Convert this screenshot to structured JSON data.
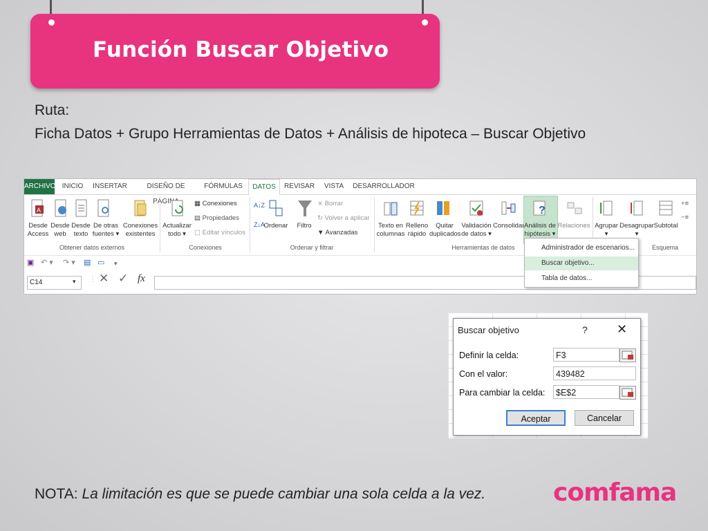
{
  "slide": {
    "title": "Función Buscar Objetivo",
    "ruta_label": "Ruta:",
    "ruta_text": "Ficha Datos + Grupo Herramientas de Datos + Análisis de hipoteca – Buscar Objetivo",
    "nota_label": "NOTA:",
    "nota_text": " La limitación es que se puede cambiar una sola celda a la vez.",
    "logo": "comfama"
  },
  "ribbon": {
    "tabs": [
      "ARCHIVO",
      "INICIO",
      "INSERTAR",
      "DISEÑO DE PÁGINA",
      "FÓRMULAS",
      "DATOS",
      "REVISAR",
      "VISTA",
      "DESARROLLADOR"
    ],
    "buttons": {
      "desde_access": "Desde\nAccess",
      "desde_web": "Desde\nweb",
      "desde_texto": "Desde\ntexto",
      "de_otras": "De otras\nfuentes ▾",
      "conexiones_existentes": "Conexiones\nexistentes",
      "actualizar": "Actualizar\ntodo ▾",
      "conexiones": "Conexiones",
      "propiedades": "Propiedades",
      "editar_vinculos": "Editar vínculos",
      "ordenar": "Ordenar",
      "filtro": "Filtro",
      "borrar": "Borrar",
      "volver_aplicar": "Volver a aplicar",
      "avanzadas": "Avanzadas",
      "texto_columnas": "Texto en\ncolumnas",
      "relleno_rapido": "Relleno\nrápido",
      "quitar_duplicados": "Quitar\nduplicados",
      "validacion": "Validación\nde datos ▾",
      "consolidar": "Consolidar",
      "analisis": "Análisis de\nhipótesis ▾",
      "relaciones": "Relaciones",
      "agrupar": "Agrupar\n▾",
      "desagrupar": "Desagrupar\n▾",
      "subtotal": "Subtotal"
    },
    "groups": {
      "externos": "Obtener datos externos",
      "conexiones": "Conexiones",
      "ordenar": "Ordenar y filtrar",
      "herramientas": "Herramientas de datos",
      "esquema": "Esquema"
    },
    "name_box": "C14",
    "fx": "fx"
  },
  "menu": {
    "items": [
      "Administrador de escenarios...",
      "Buscar objetivo...",
      "Tabla de datos..."
    ]
  },
  "dialog": {
    "title": "Buscar objetivo",
    "help": "?",
    "close": "✕",
    "definir_label": "Definir la celda:",
    "definir_value": "F3",
    "valor_label": "Con el valor:",
    "valor_value": "439482",
    "cambiar_label": "Para cambiar la celda:",
    "cambiar_value": "$E$2",
    "aceptar": "Aceptar",
    "cancelar": "Cancelar"
  },
  "colors": {
    "brand": "#e8337f",
    "excel_green": "#217346"
  }
}
